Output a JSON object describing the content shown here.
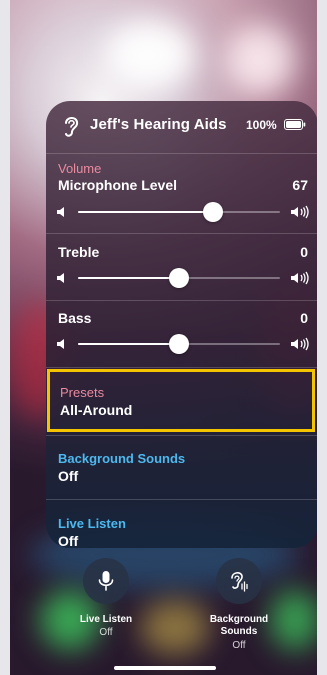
{
  "header": {
    "device_name": "Jeff's Hearing Aids",
    "battery": "100%",
    "icon": "ear-icon"
  },
  "volume": {
    "section_label": "Volume",
    "title": "Microphone Level",
    "value": "67",
    "level": 0.67
  },
  "treble": {
    "title": "Treble",
    "value": "0",
    "level": 0.5
  },
  "bass": {
    "title": "Bass",
    "value": "0",
    "level": 0.5
  },
  "presets": {
    "label": "Presets",
    "value": "All-Around",
    "highlight_color": "#f5c400"
  },
  "background_sounds": {
    "label": "Background Sounds",
    "value": "Off"
  },
  "live_listen": {
    "label": "Live Listen",
    "value": "Off"
  },
  "bottom_controls": {
    "live_listen": {
      "label": "Live Listen",
      "status": "Off",
      "icon": "microphone-icon"
    },
    "background_sounds": {
      "label": "Background\nSounds",
      "status": "Off",
      "icon": "ear-sound-icon"
    }
  },
  "colors": {
    "label_dim": "#e98a9f",
    "label_blue": "#4db8ee"
  }
}
